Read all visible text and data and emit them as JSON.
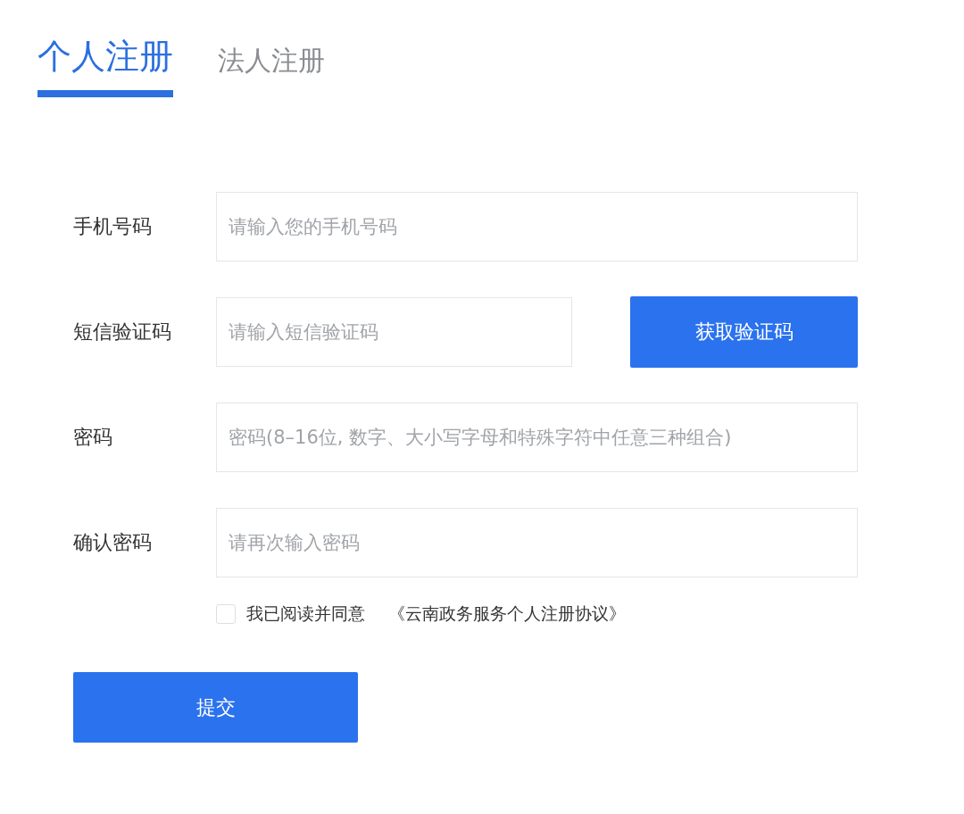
{
  "tabs": [
    {
      "label": "个人注册",
      "selected": true
    },
    {
      "label": "法人注册",
      "selected": false
    }
  ],
  "fields": [
    {
      "label": "手机号码",
      "placeholder": "请输入您的手机号码",
      "kind": "input"
    },
    {
      "label": "短信验证码",
      "placeholder": "请输入短信验证码",
      "kind": "code",
      "button": "获取验证码"
    },
    {
      "label": "密码",
      "placeholder": "密码(8–16位, 数字、大小写字母和特殊字符中任意三种组合)",
      "kind": "input"
    },
    {
      "label": "确认密码",
      "placeholder": "请再次输入密码",
      "kind": "input"
    }
  ],
  "agreement": {
    "checked": false,
    "text": "我已阅读并同意",
    "link": "《云南政务服务个人注册协议》"
  },
  "submit": "提交"
}
